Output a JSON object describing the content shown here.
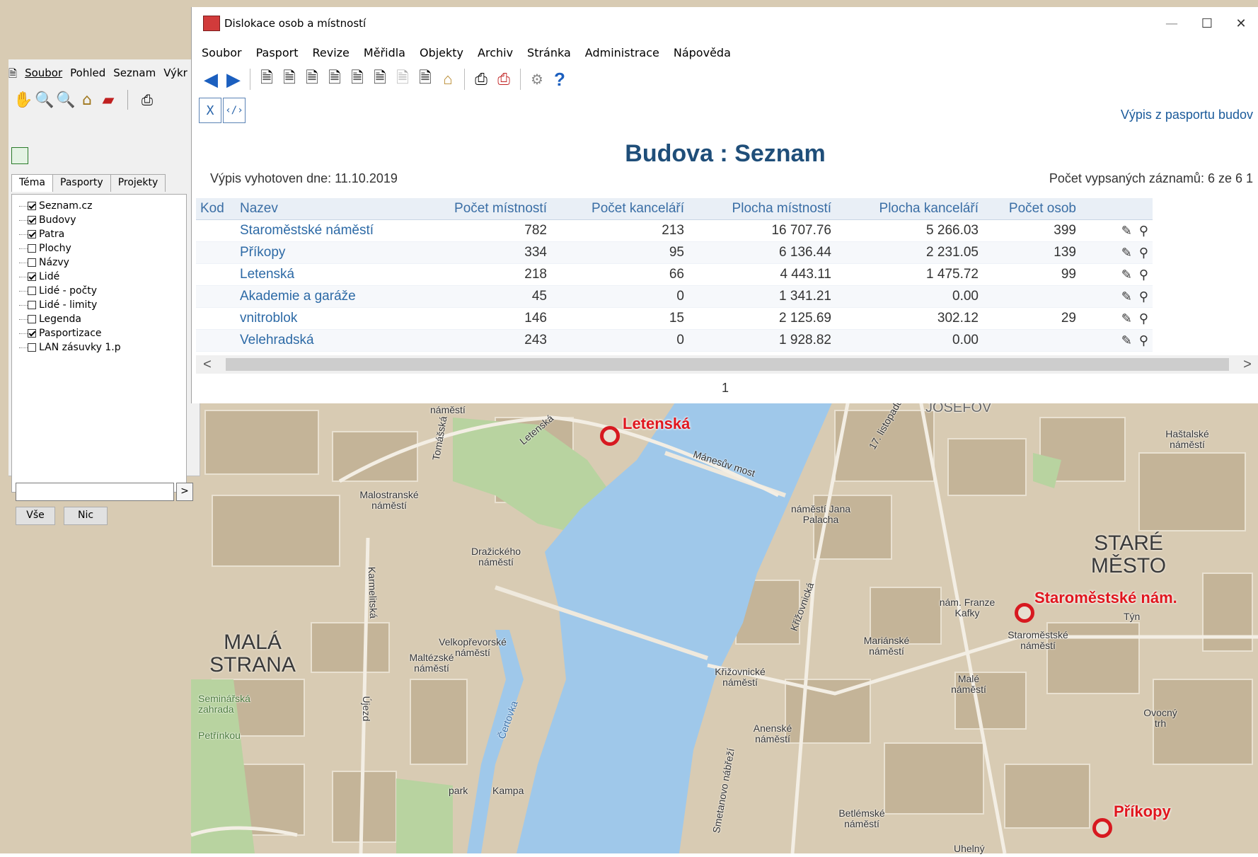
{
  "main_window": {
    "title": "Dislokace osob a místností",
    "menu": [
      "Soubor",
      "Pasport",
      "Revize",
      "Měřidla",
      "Objekty",
      "Archiv",
      "Stránka",
      "Administrace",
      "Nápověda"
    ],
    "toolbar_icons": [
      "back-arrow-icon",
      "forward-arrow-icon",
      "report-icon",
      "report-icon",
      "report-icon",
      "report-icon",
      "report-icon",
      "report-icon",
      "report-gray-icon",
      "report-r-icon",
      "building-icon",
      "printer-icon",
      "printer-alert-icon",
      "settings-icon",
      "help-icon"
    ],
    "export_buttons": [
      {
        "icon": "excel-export-icon",
        "label": "X"
      },
      {
        "icon": "xml-export-icon",
        "label": "‹/›"
      }
    ],
    "report_link": "Výpis z pasportu budov",
    "heading": "Budova : Seznam",
    "date_line": "Výpis vyhotoven dne: 11.10.2019",
    "count_line": "Počet vypsaných záznamů: 6 ze 6 1",
    "columns": [
      "Kod",
      "Nazev",
      "Počet místností",
      "Počet kanceláří",
      "Plocha místností",
      "Plocha kanceláří",
      "Počet osob"
    ],
    "rows": [
      {
        "kod": "",
        "nazev": "Staroměstské náměstí",
        "mistnosti": "782",
        "kancelari": "213",
        "plocha_m": "16 707.76",
        "plocha_k": "5 266.03",
        "osob": "399"
      },
      {
        "kod": "",
        "nazev": "Příkopy",
        "mistnosti": "334",
        "kancelari": "95",
        "plocha_m": "6 136.44",
        "plocha_k": "2 231.05",
        "osob": "139"
      },
      {
        "kod": "",
        "nazev": "Letenská",
        "mistnosti": "218",
        "kancelari": "66",
        "plocha_m": "4 443.11",
        "plocha_k": "1 475.72",
        "osob": "99"
      },
      {
        "kod": "",
        "nazev": "Akademie a garáže",
        "mistnosti": "45",
        "kancelari": "0",
        "plocha_m": "1 341.21",
        "plocha_k": "0.00",
        "osob": ""
      },
      {
        "kod": "",
        "nazev": "vnitroblok",
        "mistnosti": "146",
        "kancelari": "15",
        "plocha_m": "2 125.69",
        "plocha_k": "302.12",
        "osob": "29"
      },
      {
        "kod": "",
        "nazev": "Velehradská",
        "mistnosti": "243",
        "kancelari": "0",
        "plocha_m": "1 928.82",
        "plocha_k": "0.00",
        "osob": ""
      }
    ],
    "pager": "1"
  },
  "left_panel": {
    "menu": [
      "Soubor",
      "Pohled",
      "Seznam",
      "Výkr"
    ],
    "tabs": [
      "Téma",
      "Pasporty",
      "Projekty"
    ],
    "layers": [
      {
        "label": "Seznam.cz",
        "checked": true
      },
      {
        "label": "Budovy",
        "checked": true
      },
      {
        "label": "Patra",
        "checked": true
      },
      {
        "label": "Plochy",
        "checked": false
      },
      {
        "label": "Názvy",
        "checked": false
      },
      {
        "label": "Lidé",
        "checked": true
      },
      {
        "label": "Lidé - počty",
        "checked": false
      },
      {
        "label": "Lidé - limity",
        "checked": false
      },
      {
        "label": "Legenda",
        "checked": false
      },
      {
        "label": "Pasportizace",
        "checked": true
      },
      {
        "label": "LAN zásuvky 1.p",
        "checked": false
      }
    ],
    "go_button": ">",
    "all_button": "Vše",
    "none_button": "Nic"
  },
  "map": {
    "markers": [
      {
        "label": "Letenská"
      },
      {
        "label": "Staroměstské nám."
      },
      {
        "label": "Příkopy"
      }
    ],
    "places": [
      "náměstí",
      "Malostranské náměstí",
      "Dražického náměstí",
      "MALÁ STRANA",
      "Velkopřevorské náměstí",
      "Maltézské náměstí",
      "náměstí Jana Palacha",
      "JOSEFOV",
      "Haštalské náměstí",
      "STARÉ MĚSTO",
      "nám. Franze Kafky",
      "Týn",
      "Staroměstské náměstí",
      "Mariánské náměstí",
      "Malé náměstí",
      "Křižovnické náměstí",
      "Anenské náměstí",
      "Ovocný trh",
      "Betlémské náměstí",
      "Uhelný",
      "Kampa",
      "park",
      "Čertovka",
      "Mánesův most",
      "Letenská",
      "Tomášská",
      "Karmelitská",
      "Újezd",
      "Křižovnická",
      "17. listopadu",
      "Smetanovo nábřeží",
      "Seminářská zahrada",
      "Petřínkou"
    ]
  },
  "colors": {
    "link": "#2d6aa6",
    "header_bg": "#e9eff6",
    "marker": "#d71920",
    "water": "#9fc8ea",
    "land": "#d8cbb3"
  }
}
